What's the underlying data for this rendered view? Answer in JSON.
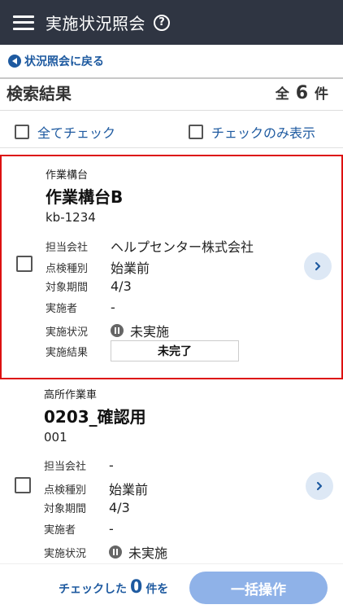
{
  "app": {
    "title": "実施状況照会"
  },
  "nav": {
    "back_label": "状況照会に戻る"
  },
  "results": {
    "title": "検索結果",
    "total_prefix": "全",
    "total": "6",
    "total_suffix": "件"
  },
  "controls": {
    "check_all_label": "全てチェック",
    "checked_only_label": "チェックのみ表示"
  },
  "field_labels": {
    "company": "担当会社",
    "inspection_type": "点検種別",
    "period": "対象期間",
    "performer": "実施者",
    "status": "実施状況",
    "result": "実施結果"
  },
  "cards": [
    {
      "category": "作業構台",
      "name": "作業構台B",
      "code": "kb-1234",
      "company": "ヘルプセンター株式会社",
      "inspection_type": "始業前",
      "period": "4/3",
      "performer": "-",
      "status": "未実施",
      "result": "未完了",
      "selected": true
    },
    {
      "category": "高所作業車",
      "name": "0203_確認用",
      "code": "001",
      "company": "-",
      "inspection_type": "始業前",
      "period": "4/3",
      "performer": "-",
      "status": "未実施",
      "result": "",
      "selected": false
    }
  ],
  "footer": {
    "prefix": "チェックした",
    "count": "0",
    "suffix": "件を",
    "bulk_label": "一括操作"
  },
  "colors": {
    "appbar": "#2f3542",
    "accent": "#1e5aa0",
    "selected_border": "#dd1111",
    "bulk_button": "#8fb2e8"
  }
}
